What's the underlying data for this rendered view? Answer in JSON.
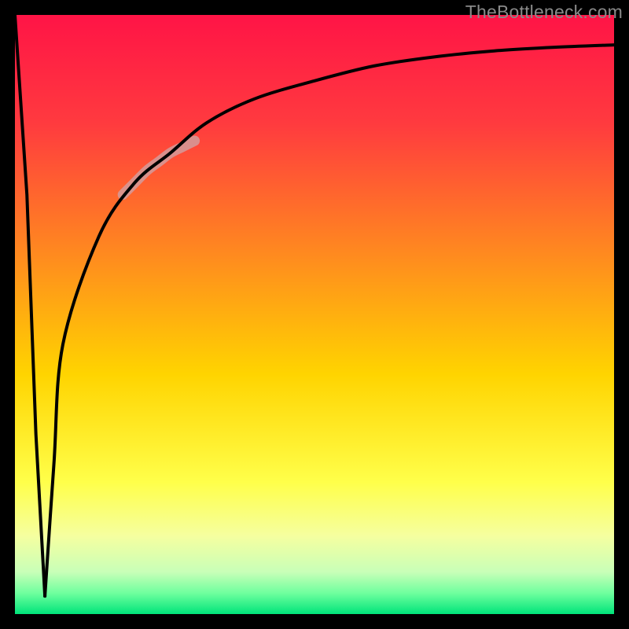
{
  "watermark": "TheBottleneck.com",
  "chart_data": {
    "type": "line",
    "title": "",
    "xlabel": "",
    "ylabel": "",
    "xlim": [
      0,
      100
    ],
    "ylim": [
      0,
      100
    ],
    "notes": "Bottleneck-percentage curve on a red(top)→yellow→green(bottom) gradient background. Sharp V-shaped minimum near x≈5 (0% bottleneck), steep rise on both sides, then asymptotic plateau near ~95% on the right. A faint pink highlight segment marks roughly x≈20–28 on the ascending limb. No axis tick labels are shown; values are estimated from position within the plot.",
    "series": [
      {
        "name": "bottleneck_curve",
        "color": "#000000",
        "x": [
          0,
          2,
          3.5,
          5,
          6.5,
          8,
          14,
          20,
          26,
          32,
          40,
          50,
          60,
          70,
          80,
          90,
          100
        ],
        "values": [
          100,
          70,
          30,
          3,
          25,
          45,
          63,
          72,
          77,
          82,
          86,
          89,
          91.5,
          93,
          94,
          94.6,
          95
        ]
      }
    ],
    "highlight_segment": {
      "name": "highlight-pink",
      "color": "#d49b9b",
      "x": [
        18,
        20,
        22,
        24,
        26,
        28,
        30
      ],
      "values": [
        70,
        72,
        74,
        75.5,
        77,
        78,
        79
      ]
    },
    "inner_border": "#000000"
  },
  "gradient_stops": [
    {
      "offset": 0.0,
      "color": "#ff1446"
    },
    {
      "offset": 0.18,
      "color": "#ff3a3f"
    },
    {
      "offset": 0.4,
      "color": "#ff8a1f"
    },
    {
      "offset": 0.6,
      "color": "#ffd400"
    },
    {
      "offset": 0.78,
      "color": "#ffff4a"
    },
    {
      "offset": 0.87,
      "color": "#f5ffa0"
    },
    {
      "offset": 0.93,
      "color": "#c8ffb8"
    },
    {
      "offset": 0.965,
      "color": "#6fff9e"
    },
    {
      "offset": 1.0,
      "color": "#00e47a"
    }
  ]
}
